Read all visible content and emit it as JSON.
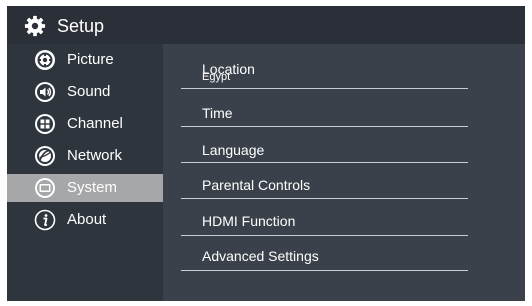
{
  "header": {
    "title": "Setup",
    "icon": "gear-icon"
  },
  "sidebar": {
    "items": [
      {
        "label": "Picture",
        "icon": "picture-icon"
      },
      {
        "label": "Sound",
        "icon": "speaker-icon"
      },
      {
        "label": "Channel",
        "icon": "channel-icon"
      },
      {
        "label": "Network",
        "icon": "globe-icon"
      },
      {
        "label": "System",
        "icon": "system-icon",
        "selected": true
      },
      {
        "label": "About",
        "icon": "info-icon"
      }
    ]
  },
  "menu": {
    "items": [
      {
        "label": "Location",
        "value": "Egypt"
      },
      {
        "label": "Time"
      },
      {
        "label": "Language"
      },
      {
        "label": "Parental Controls"
      },
      {
        "label": "HDMI Function"
      },
      {
        "label": "Advanced Settings"
      }
    ]
  },
  "colors": {
    "header_bg": "#2b3038",
    "sidebar_bg": "#2f353d",
    "content_bg": "#3b414a",
    "selected_bg": "#a6a7a9",
    "text": "#ffffff",
    "divider": "#c9ccd1"
  }
}
